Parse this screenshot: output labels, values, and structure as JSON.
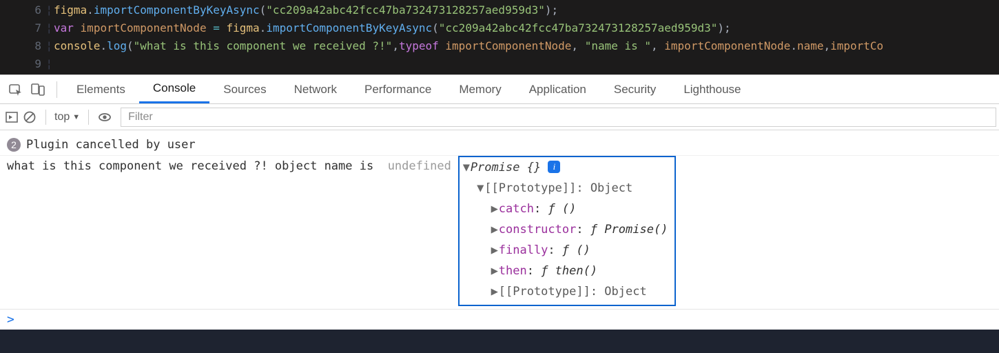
{
  "editor": {
    "lines": [
      {
        "num": "6",
        "tokens": [
          {
            "t": "figma",
            "c": "tk-obj"
          },
          {
            "t": ".",
            "c": "tk-punc"
          },
          {
            "t": "importComponentByKeyAsync",
            "c": "tk-method"
          },
          {
            "t": "(",
            "c": "tk-punc"
          },
          {
            "t": "\"cc209a42abc42fcc47ba732473128257aed959d3\"",
            "c": "tk-str"
          },
          {
            "t": ")",
            "c": "tk-punc"
          },
          {
            "t": ";",
            "c": "tk-punc"
          }
        ]
      },
      {
        "num": "7",
        "tokens": [
          {
            "t": "var",
            "c": "tk-key"
          },
          {
            "t": " ",
            "c": ""
          },
          {
            "t": "importComponentNode",
            "c": "tk-var"
          },
          {
            "t": " ",
            "c": ""
          },
          {
            "t": "=",
            "c": "tk-op"
          },
          {
            "t": " ",
            "c": ""
          },
          {
            "t": "figma",
            "c": "tk-obj"
          },
          {
            "t": ".",
            "c": "tk-punc"
          },
          {
            "t": "importComponentByKeyAsync",
            "c": "tk-method"
          },
          {
            "t": "(",
            "c": "tk-punc"
          },
          {
            "t": "\"cc209a42abc42fcc47ba732473128257aed959d3\"",
            "c": "tk-str"
          },
          {
            "t": ")",
            "c": "tk-punc"
          },
          {
            "t": ";",
            "c": "tk-punc"
          }
        ]
      },
      {
        "num": "8",
        "tokens": [
          {
            "t": "console",
            "c": "tk-obj"
          },
          {
            "t": ".",
            "c": "tk-punc"
          },
          {
            "t": "log",
            "c": "tk-method"
          },
          {
            "t": "(",
            "c": "tk-punc"
          },
          {
            "t": "\"what is this component we received ?!\"",
            "c": "tk-str"
          },
          {
            "t": ",",
            "c": "tk-punc"
          },
          {
            "t": "typeof",
            "c": "tk-key"
          },
          {
            "t": " ",
            "c": ""
          },
          {
            "t": "importComponentNode",
            "c": "tk-var"
          },
          {
            "t": ", ",
            "c": "tk-punc"
          },
          {
            "t": "\"name is \"",
            "c": "tk-str"
          },
          {
            "t": ", ",
            "c": "tk-punc"
          },
          {
            "t": "importComponentNode",
            "c": "tk-var"
          },
          {
            "t": ".",
            "c": "tk-punc"
          },
          {
            "t": "name",
            "c": "tk-var"
          },
          {
            "t": ",",
            "c": "tk-punc"
          },
          {
            "t": "importCo",
            "c": "tk-var"
          }
        ]
      },
      {
        "num": "9",
        "tokens": []
      }
    ]
  },
  "devtools": {
    "tabs": [
      "Elements",
      "Console",
      "Sources",
      "Network",
      "Performance",
      "Memory",
      "Application",
      "Security",
      "Lighthouse"
    ],
    "active_tab": "Console",
    "context": {
      "label": "top",
      "caret": "▼"
    },
    "filter_placeholder": "Filter"
  },
  "console": {
    "warn_count": "2",
    "warn_msg": "Plugin cancelled by user",
    "log_prefix": "what is this component we received ?! object name is  ",
    "undefined": "undefined",
    "promise_header": "Promise {}",
    "info_glyph": "i",
    "proto_label": "[[Prototype]]: Object",
    "props": [
      {
        "name": "catch",
        "sig": "ƒ ()"
      },
      {
        "name": "constructor",
        "sig": "ƒ Promise()"
      },
      {
        "name": "finally",
        "sig": "ƒ ()"
      },
      {
        "name": "then",
        "sig": "ƒ then()"
      }
    ],
    "inner_proto": "[[Prototype]]: Object",
    "prompt": ">"
  }
}
